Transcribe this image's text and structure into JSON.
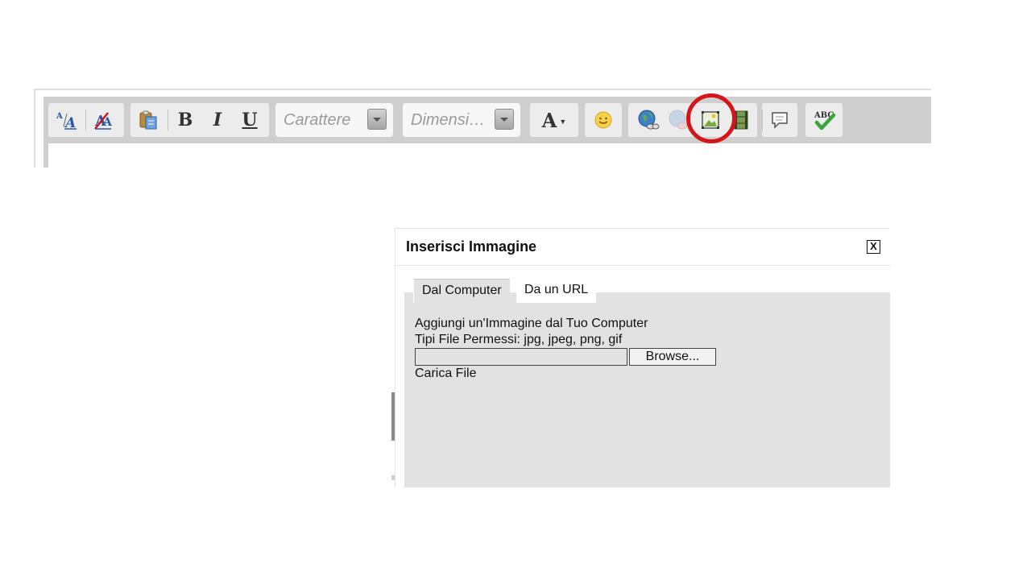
{
  "toolbar": {
    "font_placeholder": "Carattere",
    "size_placeholder": "Dimensi…",
    "bold_label": "B",
    "italic_label": "I",
    "underline_label": "U",
    "font_color_label": "A",
    "spellcheck_label": "ABC",
    "highlight_color": "#d4151b"
  },
  "dialog": {
    "title": "Inserisci Immagine",
    "close_label": "X",
    "tabs": [
      {
        "label": "Dal Computer",
        "active": true
      },
      {
        "label": "Da un URL",
        "active": false
      }
    ],
    "heading": "Aggiungi un'Immagine dal Tuo Computer",
    "allowed_types": "Tipi File Permessi: jpg, jpeg, png, gif",
    "file_value": "",
    "browse_label": "Browse...",
    "upload_label": "Carica File"
  }
}
